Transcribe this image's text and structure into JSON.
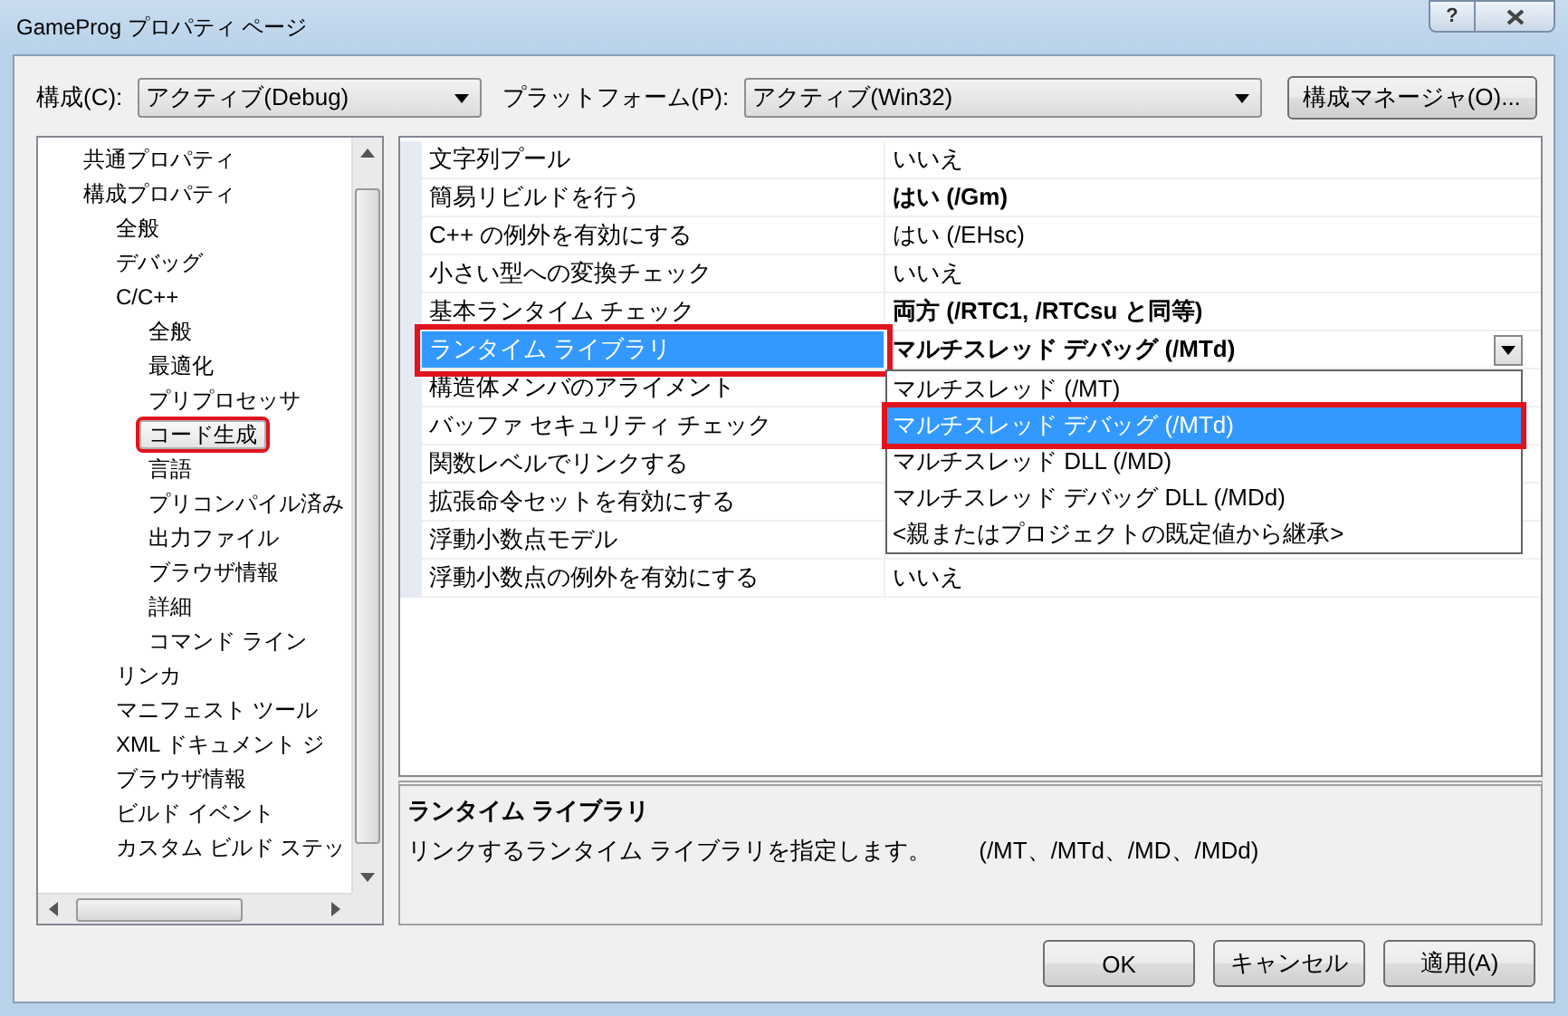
{
  "window": {
    "title": "GameProg プロパティ ページ",
    "help_button": "?"
  },
  "toolbar": {
    "config_label": "構成(C):",
    "config_value": "アクティブ(Debug)",
    "platform_label": "プラットフォーム(P):",
    "platform_value": "アクティブ(Win32)",
    "manager_button": "構成マネージャ(O)..."
  },
  "tree": [
    {
      "label": "共通プロパティ",
      "selected": false
    },
    {
      "label": "構成プロパティ",
      "selected": false,
      "children": [
        {
          "label": "全般",
          "selected": false
        },
        {
          "label": "デバッグ",
          "selected": false
        },
        {
          "label": "C/C++",
          "selected": false,
          "children": [
            {
              "label": "全般",
              "selected": false
            },
            {
              "label": "最適化",
              "selected": false
            },
            {
              "label": "プリプロセッサ",
              "selected": false
            },
            {
              "label": "コード生成",
              "selected": true,
              "annotated": true
            },
            {
              "label": "言語",
              "selected": false
            },
            {
              "label": "プリコンパイル済み",
              "selected": false
            },
            {
              "label": "出力ファイル",
              "selected": false
            },
            {
              "label": "ブラウザ情報",
              "selected": false
            },
            {
              "label": "詳細",
              "selected": false
            },
            {
              "label": "コマンド ライン",
              "selected": false
            }
          ]
        },
        {
          "label": "リンカ",
          "selected": false
        },
        {
          "label": "マニフェスト ツール",
          "selected": false
        },
        {
          "label": "XML ドキュメント ジ",
          "selected": false
        },
        {
          "label": "ブラウザ情報",
          "selected": false
        },
        {
          "label": "ビルド イベント",
          "selected": false
        },
        {
          "label": "カスタム ビルド ステッ",
          "selected": false
        }
      ]
    }
  ],
  "properties": [
    {
      "name": "文字列プール",
      "value": "いいえ",
      "bold": false,
      "selected": false
    },
    {
      "name": "簡易リビルドを行う",
      "value": "はい (/Gm)",
      "bold": true,
      "selected": false
    },
    {
      "name": "C++ の例外を有効にする",
      "value": "はい (/EHsc)",
      "bold": false,
      "selected": false
    },
    {
      "name": "小さい型への変換チェック",
      "value": "いいえ",
      "bold": false,
      "selected": false
    },
    {
      "name": "基本ランタイム チェック",
      "value": "両方 (/RTC1, /RTCsu と同等)",
      "bold": true,
      "selected": false
    },
    {
      "name": "ランタイム ライブラリ",
      "value": "マルチスレッド デバッグ (/MTd)",
      "bold": true,
      "selected": true,
      "annotated": true
    },
    {
      "name": "構造体メンバのアライメント",
      "selected": false
    },
    {
      "name": "バッファ セキュリティ チェック",
      "selected": false
    },
    {
      "name": "関数レベルでリンクする",
      "selected": false
    },
    {
      "name": "拡張命令セットを有効にする",
      "selected": false
    },
    {
      "name": "浮動小数点モデル",
      "selected": false
    },
    {
      "name": "浮動小数点の例外を有効にする",
      "value": "いいえ",
      "bold": false,
      "selected": false
    }
  ],
  "dropdown_options": [
    {
      "label": "マルチスレッド (/MT)",
      "selected": false
    },
    {
      "label": "マルチスレッド デバッグ (/MTd)",
      "selected": true,
      "annotated": true
    },
    {
      "label": "マルチスレッド DLL (/MD)",
      "selected": false
    },
    {
      "label": "マルチスレッド デバッグ DLL (/MDd)",
      "selected": false
    },
    {
      "label": "<親またはプロジェクトの既定値から継承>",
      "selected": false
    }
  ],
  "description": {
    "title": "ランタイム ライブラリ",
    "text": "リンクするランタイム ライブラリを指定します。　　(/MT、/MTd、/MD、/MDd)"
  },
  "buttons": [
    "OK",
    "キャンセル",
    "適用(A)"
  ]
}
